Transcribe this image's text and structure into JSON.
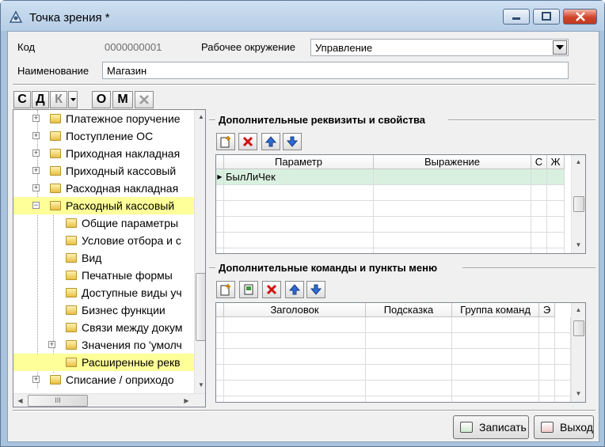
{
  "window": {
    "title": "Точка зрения *"
  },
  "form": {
    "code_label": "Код",
    "code_value": "0000000001",
    "env_label": "Рабочее окружение",
    "env_value": "Управление",
    "name_label": "Наименование",
    "name_value": "Магазин"
  },
  "tree_toolbar": [
    "С",
    "Д",
    "К",
    "О",
    "М"
  ],
  "tree": {
    "items": [
      {
        "label": "Платежное поручение",
        "folder": "doc",
        "expander": "+"
      },
      {
        "label": "Поступление ОС",
        "folder": "doc",
        "expander": "+"
      },
      {
        "label": "Приходная накладная",
        "folder": "doc",
        "expander": "+"
      },
      {
        "label": "Приходный кассовый",
        "folder": "doc",
        "expander": "+"
      },
      {
        "label": "Расходная накладная",
        "folder": "doc",
        "expander": "+"
      },
      {
        "label": "Расходный кассовый",
        "folder": "doc",
        "expander": "−"
      },
      {
        "label": "Общие параметры",
        "folder": "plain",
        "expander": ""
      },
      {
        "label": "Условие отбора и с",
        "folder": "plain",
        "expander": ""
      },
      {
        "label": "Вид",
        "folder": "plain",
        "expander": ""
      },
      {
        "label": "Печатные формы",
        "folder": "plain",
        "expander": ""
      },
      {
        "label": "Доступные виды уч",
        "folder": "plain",
        "expander": ""
      },
      {
        "label": "Бизнес функции",
        "folder": "plain",
        "expander": ""
      },
      {
        "label": "Связи между докум",
        "folder": "plain",
        "expander": ""
      },
      {
        "label": "Значения по 'умолч",
        "folder": "plain",
        "expander": "+"
      },
      {
        "label": "Расширенные рекв",
        "folder": "plain",
        "expander": ""
      },
      {
        "label": "Списание / оприходо",
        "folder": "doc",
        "expander": "+"
      }
    ],
    "scroll_h_grip": "III"
  },
  "section1": {
    "title": "Дополнительные реквизиты и свойства",
    "columns": [
      "Параметр",
      "Выражение",
      "С",
      "Ж"
    ],
    "rows": [
      [
        "БылЛиЧек",
        "",
        "",
        ""
      ]
    ]
  },
  "section2": {
    "title": "Дополнительные команды и пункты меню",
    "columns": [
      "Заголовок",
      "Подсказка",
      "Группа команд",
      "Э"
    ],
    "rows": []
  },
  "buttons": {
    "save": "Записать",
    "exit": "Выход"
  }
}
